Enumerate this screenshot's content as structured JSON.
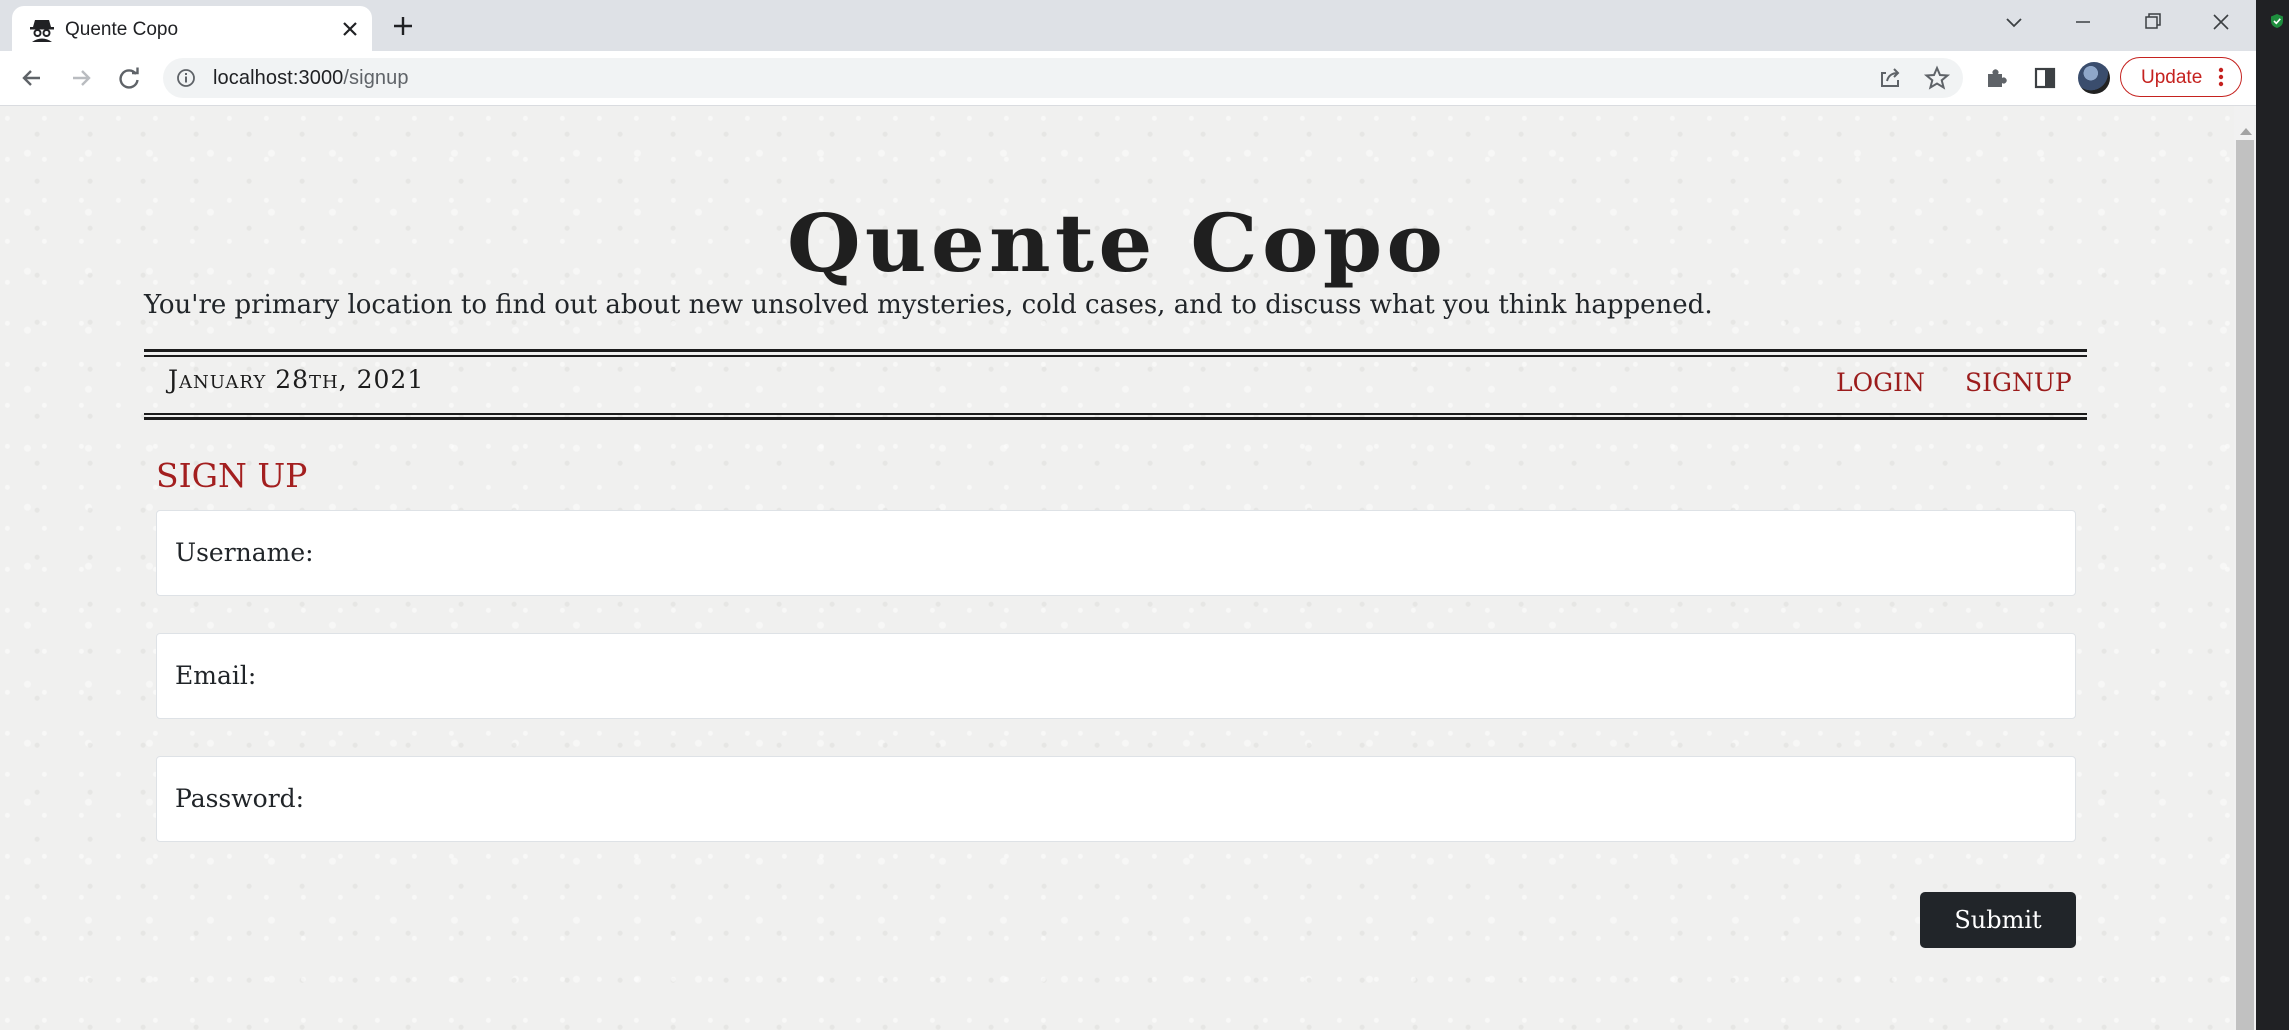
{
  "browser": {
    "tab_title": "Quente Copo",
    "url_host": "localhost:3000",
    "url_path": "/signup",
    "update_label": "Update"
  },
  "site": {
    "title": "Quente Copo",
    "tagline": "You're primary location to find out about new unsolved mysteries, cold cases, and to discuss what you think happened.",
    "date": "January 28th, 2021",
    "nav": {
      "login": "LOGIN",
      "signup": "SIGNUP"
    }
  },
  "form": {
    "heading": "SIGN UP",
    "fields": [
      {
        "label": "Username:",
        "value": ""
      },
      {
        "label": "Email:",
        "value": ""
      },
      {
        "label": "Password:",
        "value": ""
      }
    ],
    "submit_label": "Submit"
  },
  "colors": {
    "accent": "#a31f1f",
    "button": "#212529",
    "page_bg": "#f0f0ef"
  },
  "icons": [
    "detective-favicon-icon",
    "close-icon",
    "plus-icon",
    "chevron-down-icon",
    "minimize-icon",
    "restore-icon",
    "window-close-icon",
    "back-arrow-icon",
    "forward-arrow-icon",
    "reload-icon",
    "info-icon",
    "share-icon",
    "star-icon",
    "puzzle-icon",
    "sidepanel-icon",
    "kebab-menu-icon",
    "shield-icon"
  ]
}
